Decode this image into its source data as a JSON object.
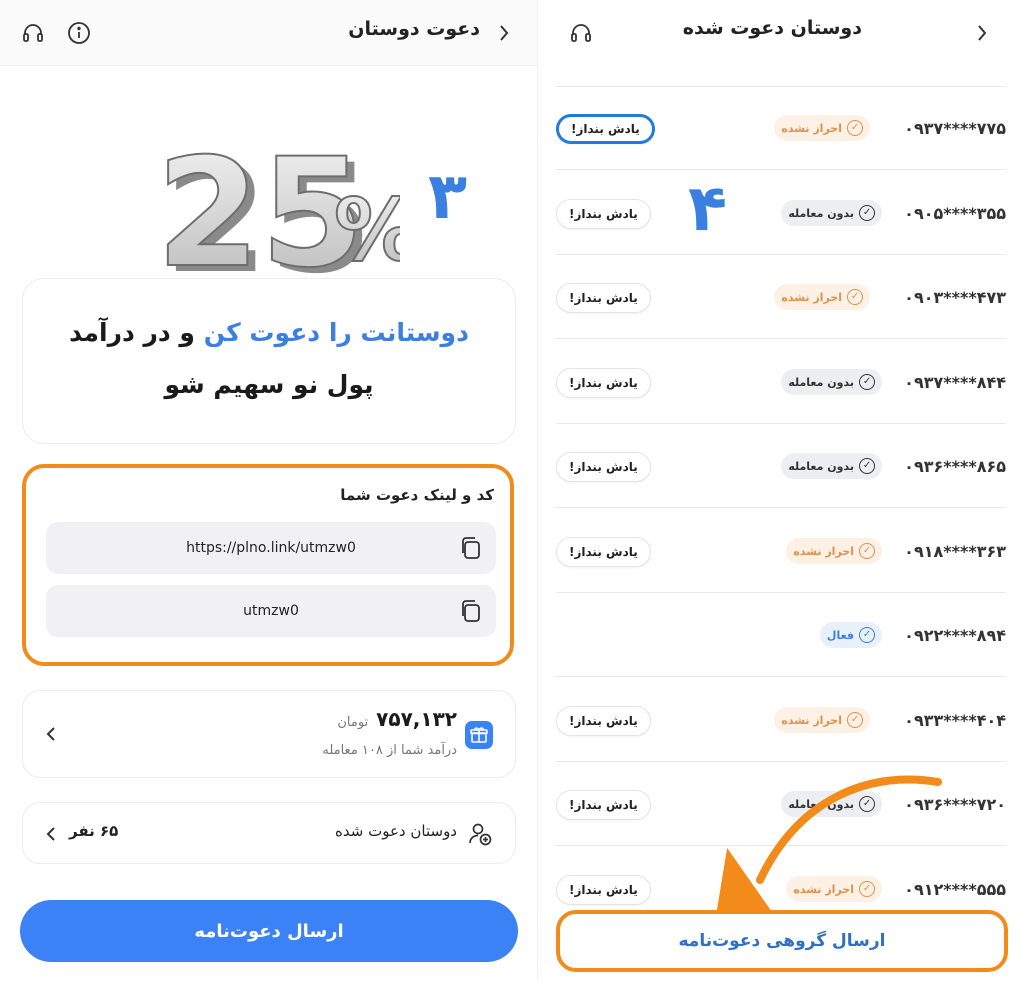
{
  "left": {
    "header": {
      "title": "دعوت دوستان"
    },
    "hero": {
      "percent": "25",
      "percent_sign": "%"
    },
    "step_label": "۳",
    "headline": {
      "line1_highlight": "دوستانت را دعوت کن",
      "line1_rest": " و در درآمد",
      "line2": "پول نو سهیم شو"
    },
    "invite": {
      "label": "کد و لینک دعوت شما",
      "link": "https://plno.link/utmzw0",
      "code": "utmzw0"
    },
    "income": {
      "amount": "۷۵۷,۱۳۲",
      "unit": "تومان",
      "subtitle": "درآمد شما از ۱۰۸ معامله"
    },
    "invited_friends": {
      "label": "دوستان دعوت شده",
      "count": "۶۵ نفر"
    },
    "send_button": "ارسال دعوت‌نامه"
  },
  "right": {
    "header": {
      "title": "دوستان دعوت شده"
    },
    "step_label": "۴",
    "rows": [
      {
        "phone": "۰۹۳۷****۷۷۵",
        "status": "احراز نشده",
        "kind": "warn",
        "remind": "یادش بنداز!"
      },
      {
        "phone": "۰۹۰۵****۳۵۵",
        "status": "بدون معامله",
        "kind": "neutral",
        "remind": "یادش بنداز!"
      },
      {
        "phone": "۰۹۰۳****۴۷۳",
        "status": "احراز نشده",
        "kind": "warn",
        "remind": "یادش بنداز!"
      },
      {
        "phone": "۰۹۳۷****۸۴۴",
        "status": "بدون معامله",
        "kind": "neutral",
        "remind": "یادش بنداز!"
      },
      {
        "phone": "۰۹۳۶****۸۶۵",
        "status": "بدون معامله",
        "kind": "neutral",
        "remind": "یادش بنداز!"
      },
      {
        "phone": "۰۹۱۸****۳۶۳",
        "status": "احراز نشده",
        "kind": "warn",
        "remind": "یادش بنداز!"
      },
      {
        "phone": "۰۹۲۲****۸۹۴",
        "status": "فعال",
        "kind": "active",
        "remind": ""
      },
      {
        "phone": "۰۹۳۳****۴۰۴",
        "status": "احراز نشده",
        "kind": "warn",
        "remind": "یادش بنداز!"
      },
      {
        "phone": "۰۹۳۶****۷۲۰",
        "status": "بدون معامله",
        "kind": "neutral",
        "remind": "یادش بنداز!"
      },
      {
        "phone": "۰۹۱۲****۵۵۵",
        "status": "احراز نشده",
        "kind": "warn",
        "remind": "یادش بنداز!"
      }
    ],
    "group_button": "ارسال گروهی دعوت‌نامه"
  },
  "colors": {
    "primary": "#3b82f6",
    "highlight_orange": "#f28b1a",
    "accent_blue_text": "#3b7fe0",
    "circle_blue": "#1f7be0"
  },
  "icons": [
    "headset-icon",
    "info-icon",
    "chevron-right-icon",
    "copy-icon",
    "gift-icon",
    "chevron-left-icon",
    "add-user-icon",
    "check-circle-icon"
  ]
}
